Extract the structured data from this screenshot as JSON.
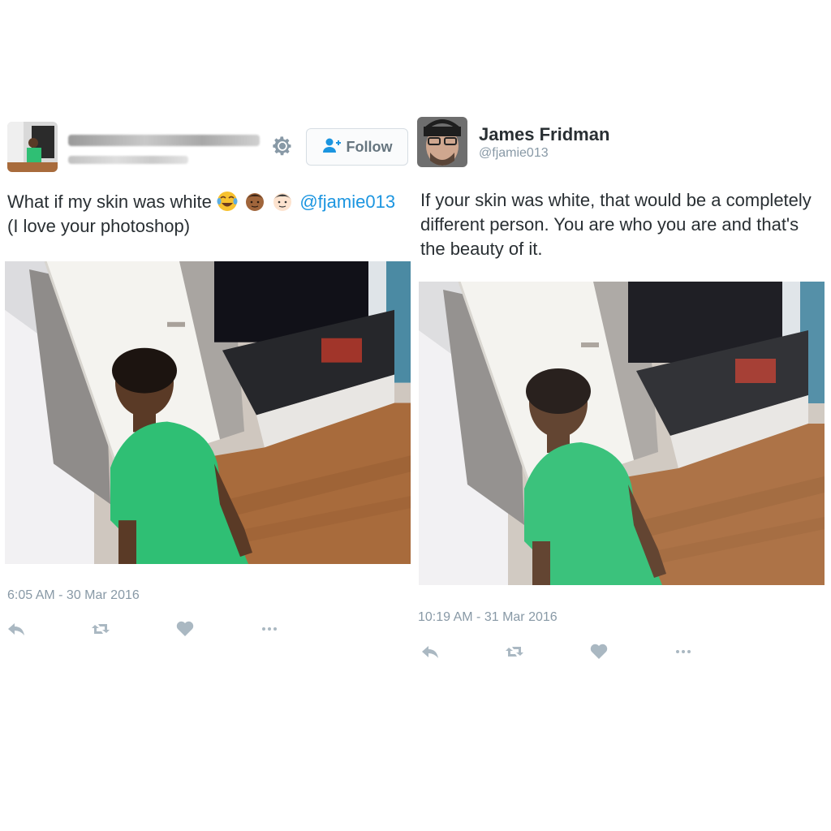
{
  "left_tweet": {
    "follow_label": "Follow",
    "text_line1": "What if my skin was white",
    "text_line2": "(I love your photoshop)",
    "mention": "@fjamie013",
    "emojis": [
      "face-with-tears-of-joy",
      "boy-dark-skin-tone",
      "boy-light-skin-tone"
    ],
    "timestamp": "6:05 AM - 30 Mar 2016",
    "actions": [
      "reply-icon",
      "retweet-icon",
      "heart-icon",
      "more-icon"
    ]
  },
  "right_tweet": {
    "display_name": "James Fridman",
    "handle": "@fjamie013",
    "text": "If your skin was white, that would be a completely different person. You are who you are and that's the beauty of it.",
    "timestamp": "10:19 AM - 31 Mar 2016",
    "actions": [
      "reply-icon",
      "retweet-icon",
      "heart-icon",
      "more-icon"
    ]
  },
  "colors": {
    "link": "#1b95e0",
    "muted": "#8899a6",
    "text": "#292f33",
    "icon": "#aab8c2"
  }
}
